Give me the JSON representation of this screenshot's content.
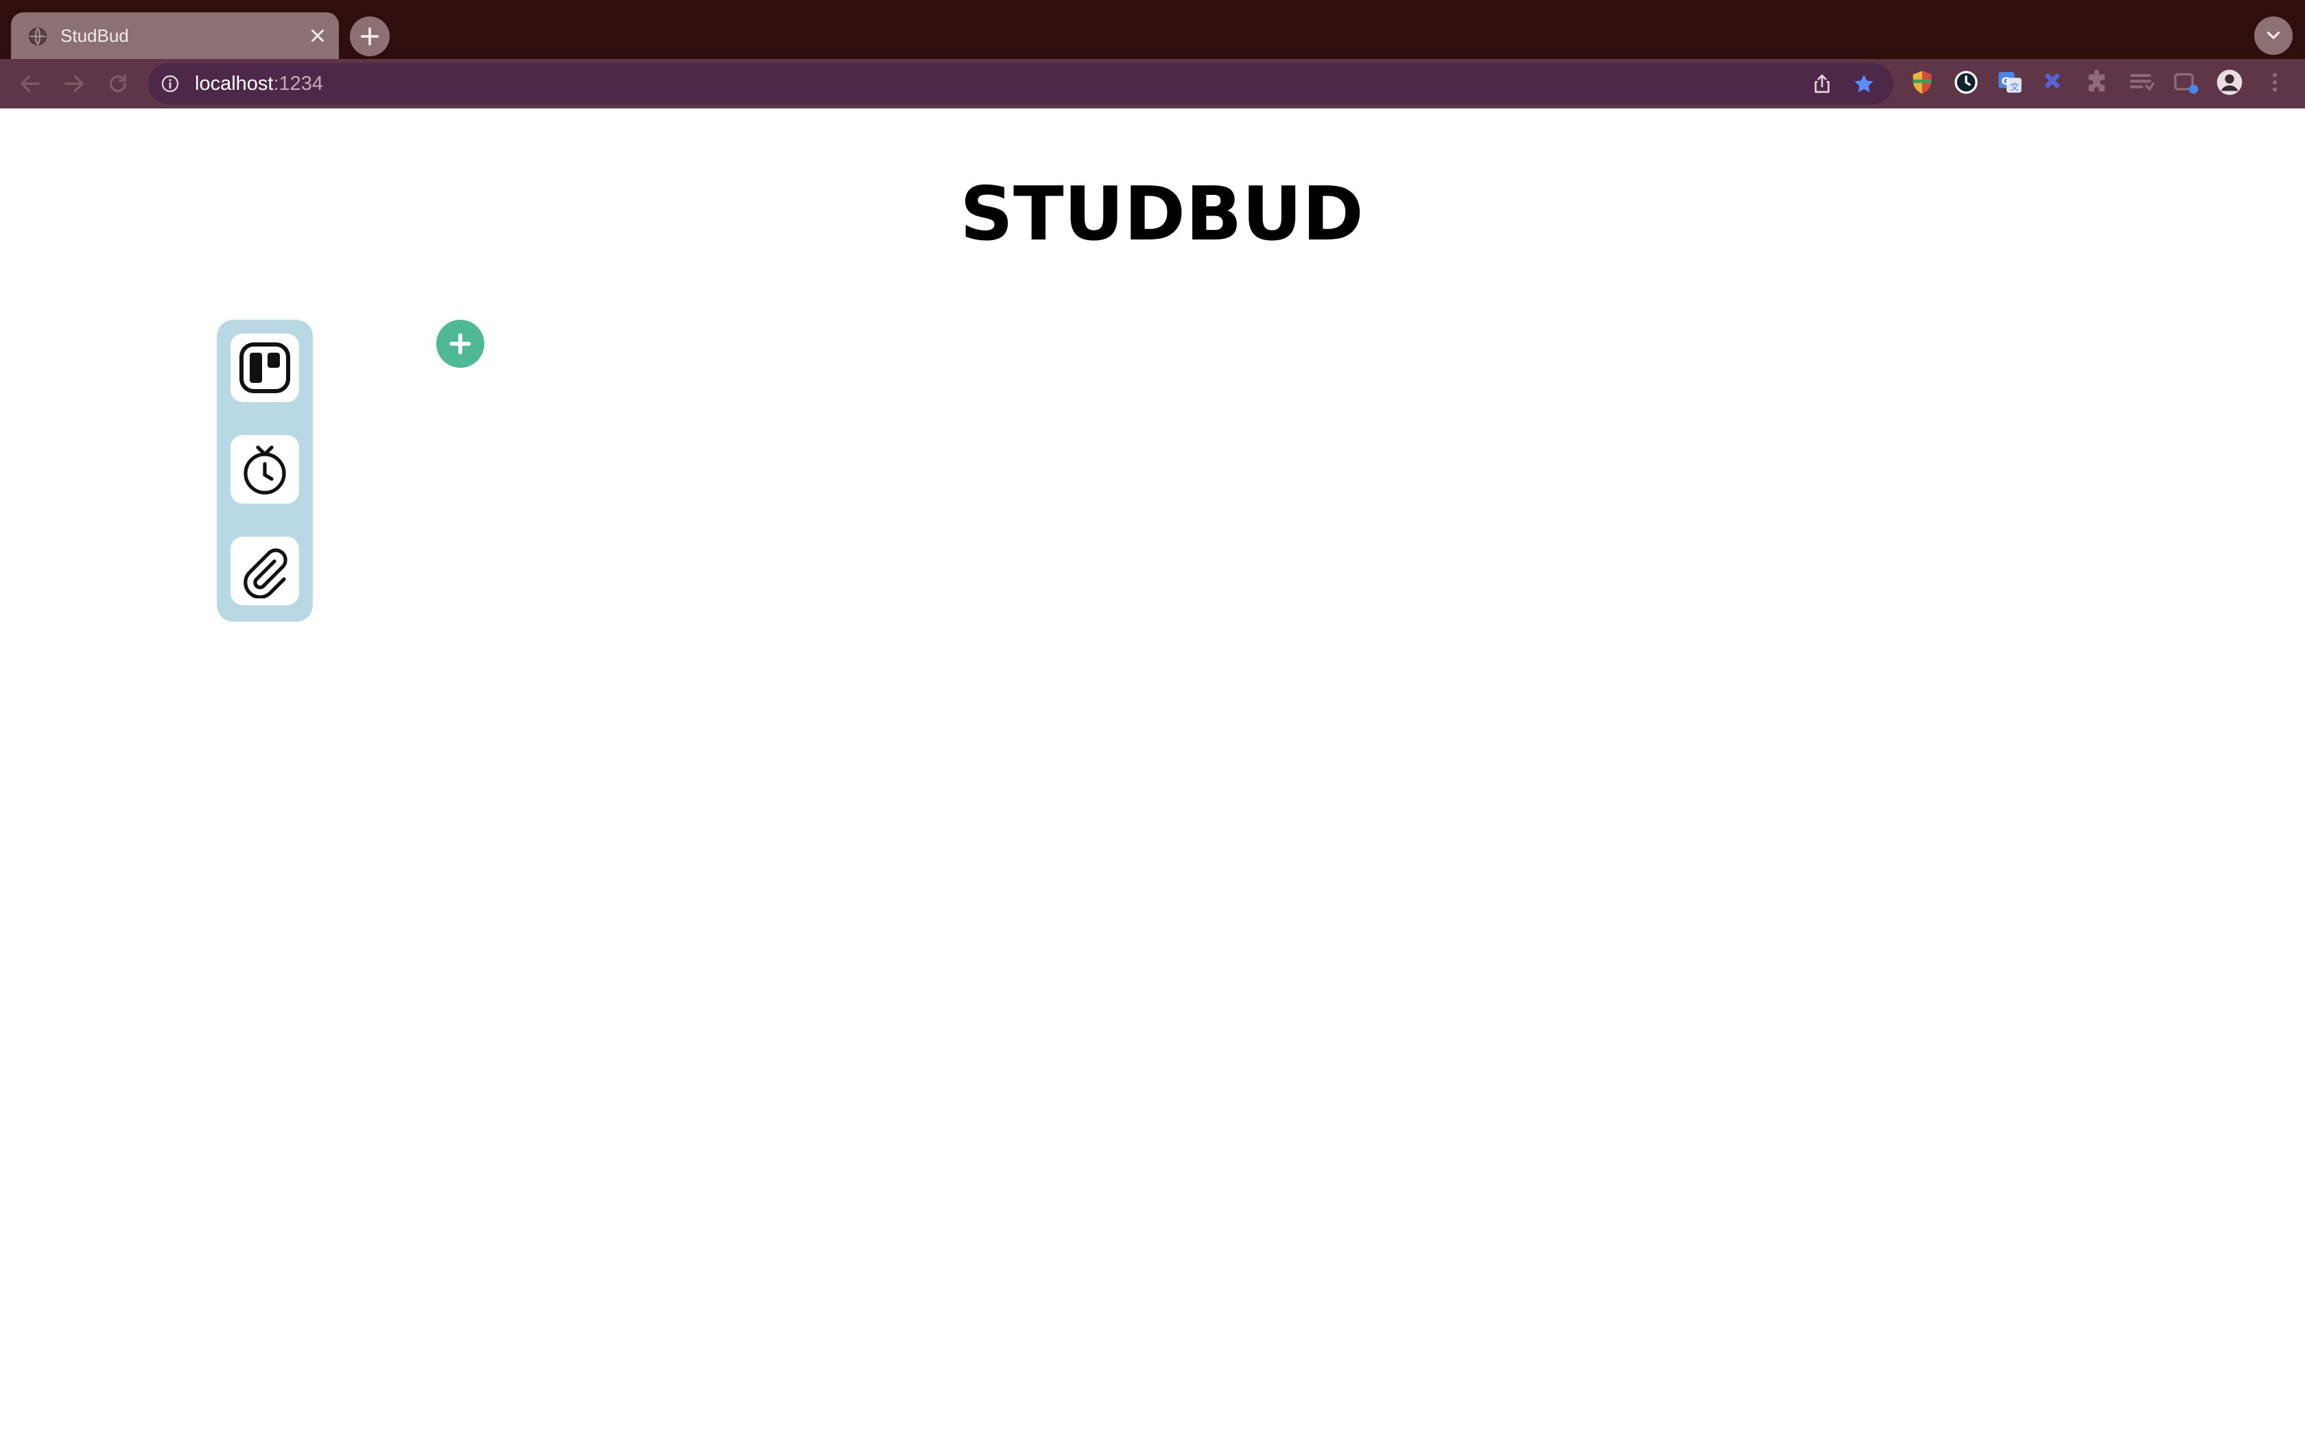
{
  "browser": {
    "tab_title": "StudBud",
    "url_host": "localhost",
    "url_port": ":1234",
    "icons": {
      "favicon": "globe-icon",
      "tab_close": "close-icon",
      "new_tab": "plus-icon",
      "tab_search": "chevron-down-icon",
      "back": "back-arrow-icon",
      "forward": "forward-arrow-icon",
      "reload": "reload-icon",
      "site_info": "info-icon",
      "share": "share-icon",
      "bookmark": "star-icon"
    },
    "extensions": [
      "shield-extension-icon",
      "clock-extension-icon",
      "translate-extension-icon",
      "puzzle-blue-extension-icon",
      "puzzle-icon",
      "reading-list-icon",
      "tab-manager-icon",
      "profile-icon",
      "menu-icon"
    ],
    "colors": {
      "frame": "#310e0e",
      "active_tab": "#8d7073",
      "toolbar": "#5e3647",
      "omnibox": "#4d2848",
      "bookmark_star": "#5b8cff"
    }
  },
  "app": {
    "title": "STUDBUD",
    "nav": [
      {
        "name": "kanban-board",
        "icon": "kanban-icon"
      },
      {
        "name": "stopwatch",
        "icon": "stopwatch-icon"
      },
      {
        "name": "attachments",
        "icon": "paperclip-icon"
      }
    ],
    "add_button_icon": "plus-icon",
    "colors": {
      "nav_panel": "#b8d8e3",
      "nav_tile": "#ffffff",
      "add_button": "#4fb895"
    }
  }
}
